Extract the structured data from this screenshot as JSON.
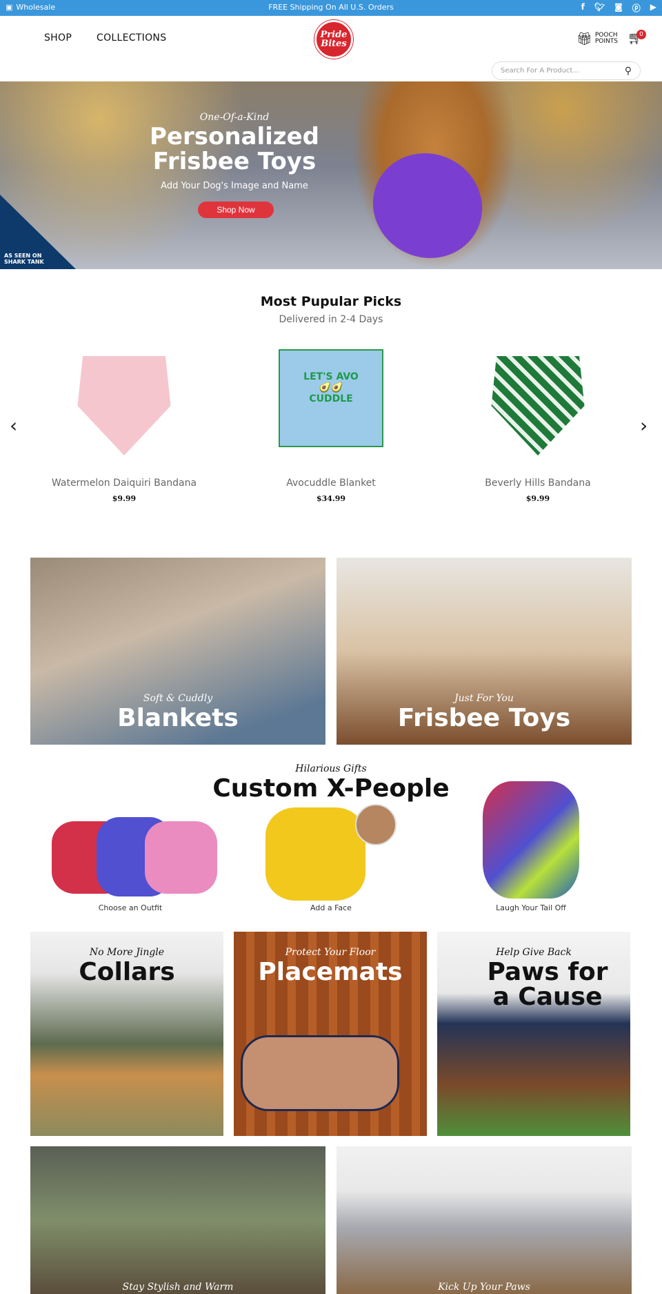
{
  "topbar": {
    "wholesale": "Wholesale",
    "shipping": "FREE Shipping On All U.S. Orders",
    "social": [
      "f",
      "t",
      "ig",
      "p",
      "yt"
    ]
  },
  "header": {
    "nav": [
      "SHOP",
      "COLLECTIONS"
    ],
    "logo": "Pride Bites",
    "pooch_points": "POOCH POINTS",
    "cart_count": "0",
    "search_placeholder": "Search For A Product..."
  },
  "hero": {
    "kicker": "One-Of-a-Kind",
    "title1": "Personalized",
    "title2": "Frisbee Toys",
    "subtitle": "Add Your Dog's Image and Name",
    "cta": "Shop Now",
    "shark": "AS SEEN ON SHARK TANK"
  },
  "popular": {
    "title": "Most Pupular Picks",
    "subtitle": "Delivered in 2-4 Days",
    "products": [
      {
        "name": "Watermelon Daiquiri Bandana",
        "price": "$9.99"
      },
      {
        "name": "Avocuddle Blanket",
        "price": "$34.99"
      },
      {
        "name": "Beverly Hills Bandana",
        "price": "$9.99"
      }
    ]
  },
  "tiles": {
    "blankets": {
      "sub": "Soft & Cuddly",
      "title": "Blankets"
    },
    "frisbee": {
      "sub": "Just For You",
      "title": "Frisbee Toys"
    },
    "xpeople": {
      "sub": "Hilarious Gifts",
      "title": "Custom X-People",
      "steps": [
        "Choose an Outfit",
        "Add a Face",
        "Laugh Your Tail Off"
      ]
    },
    "collars": {
      "sub": "No More Jingle",
      "title": "Collars"
    },
    "placemats": {
      "sub": "Protect Your Floor",
      "title": "Placemats"
    },
    "cause": {
      "sub": "Help Give Back",
      "title1": "Paws for",
      "title2": "a Cause"
    },
    "apparel": {
      "sub": "Stay Stylish and Warm"
    },
    "beds": {
      "sub": "Kick Up Your Paws"
    }
  }
}
